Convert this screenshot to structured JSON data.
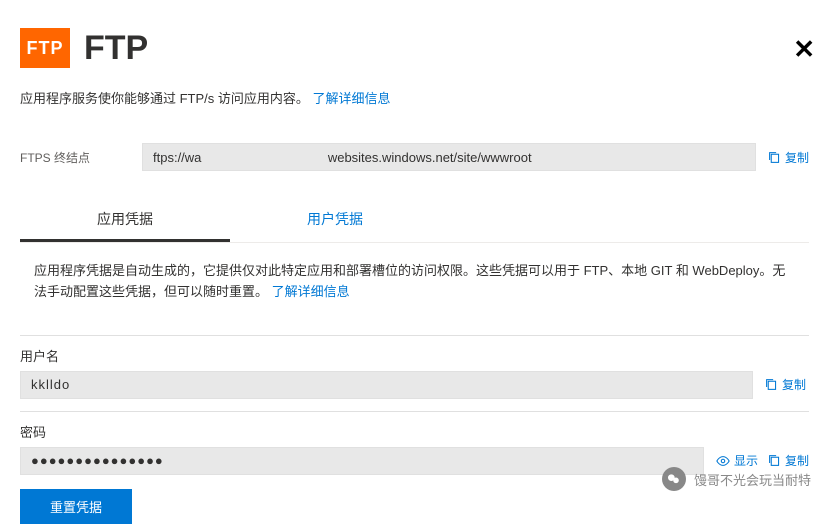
{
  "header": {
    "logo_text": "FTP",
    "title": "FTP"
  },
  "description": {
    "text": "应用程序服务使你能够通过 FTP/s 访问应用内容。",
    "link": "了解详细信息"
  },
  "endpoint": {
    "label": "FTPS 终结点",
    "value": "ftps://wa                                   websites.windows.net/site/wwwroot",
    "copy": "复制"
  },
  "tabs": {
    "app": "应用凭据",
    "user": "用户凭据"
  },
  "credentials_desc": {
    "text": "应用程序凭据是自动生成的，它提供仅对此特定应用和部署槽位的访问权限。这些凭据可以用于 FTP、本地 GIT 和 WebDeploy。无法手动配置这些凭据，但可以随时重置。",
    "link": "了解详细信息"
  },
  "username": {
    "label": "用户名",
    "value": "kklldo",
    "copy": "复制"
  },
  "password": {
    "label": "密码",
    "value": "●●●●●●●●●●●●●●●",
    "show": "显示",
    "copy": "复制"
  },
  "reset_button": "重置凭据",
  "watermark": "馒哥不光会玩当耐特"
}
